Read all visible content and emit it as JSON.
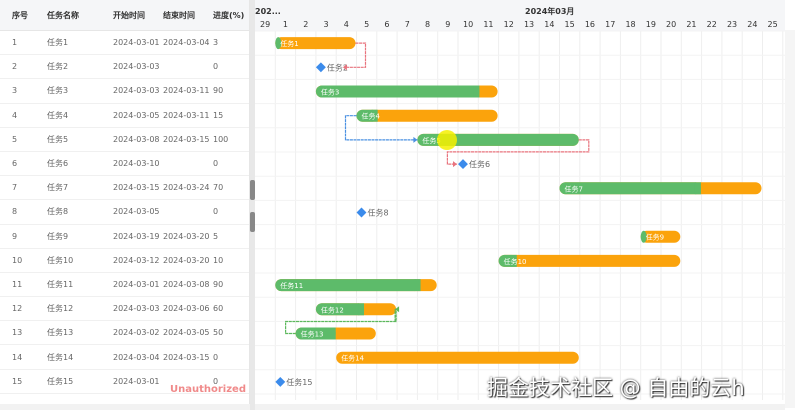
{
  "table": {
    "headers": [
      "序号",
      "任务名称",
      "开始时间",
      "结束时间",
      "进度(%)"
    ],
    "rows": [
      [
        "1",
        "任务1",
        "2024-03-01",
        "2024-03-04",
        "3"
      ],
      [
        "2",
        "任务2",
        "2024-03-03",
        "",
        "0"
      ],
      [
        "3",
        "任务3",
        "2024-03-03",
        "2024-03-11",
        "90"
      ],
      [
        "4",
        "任务4",
        "2024-03-05",
        "2024-03-11",
        "15"
      ],
      [
        "5",
        "任务5",
        "2024-03-08",
        "2024-03-15",
        "100"
      ],
      [
        "6",
        "任务6",
        "2024-03-10",
        "",
        "0"
      ],
      [
        "7",
        "任务7",
        "2024-03-15",
        "2024-03-24",
        "70"
      ],
      [
        "8",
        "任务8",
        "2024-03-05",
        "",
        "0"
      ],
      [
        "9",
        "任务9",
        "2024-03-19",
        "2024-03-20",
        "5"
      ],
      [
        "10",
        "任务10",
        "2024-03-12",
        "2024-03-20",
        "10"
      ],
      [
        "11",
        "任务11",
        "2024-03-01",
        "2024-03-08",
        "90"
      ],
      [
        "12",
        "任务12",
        "2024-03-03",
        "2024-03-06",
        "60"
      ],
      [
        "13",
        "任务13",
        "2024-03-02",
        "2024-03-05",
        "50"
      ],
      [
        "14",
        "任务14",
        "2024-03-04",
        "2024-03-15",
        "0"
      ],
      [
        "15",
        "任务15",
        "2024-03-01",
        "",
        "0"
      ]
    ]
  },
  "gantt": {
    "prev_month_label": "202...",
    "month_label": "2024年03月",
    "days": [
      "29",
      "1",
      "2",
      "3",
      "4",
      "5",
      "6",
      "7",
      "8",
      "9",
      "10",
      "11",
      "12",
      "13",
      "14",
      "15",
      "16",
      "17",
      "18",
      "19",
      "20",
      "21",
      "22",
      "23",
      "24",
      "25"
    ],
    "tasks": [
      {
        "name": "任务1",
        "start": 1,
        "end": 4,
        "progress": 3,
        "type": "bar"
      },
      {
        "name": "任务2",
        "start": 3,
        "type": "milestone"
      },
      {
        "name": "任务3",
        "start": 3,
        "end": 11,
        "progress": 90,
        "type": "bar"
      },
      {
        "name": "任务4",
        "start": 5,
        "end": 11,
        "progress": 15,
        "type": "bar"
      },
      {
        "name": "任务5",
        "start": 8,
        "end": 15,
        "progress": 100,
        "type": "bar"
      },
      {
        "name": "任务6",
        "start": 10,
        "type": "milestone"
      },
      {
        "name": "任务7",
        "start": 15,
        "end": 24,
        "progress": 70,
        "type": "bar"
      },
      {
        "name": "任务8",
        "start": 5,
        "type": "milestone"
      },
      {
        "name": "任务9",
        "start": 19,
        "end": 20,
        "progress": 5,
        "type": "bar"
      },
      {
        "name": "任务10",
        "start": 12,
        "end": 20,
        "progress": 10,
        "type": "bar"
      },
      {
        "name": "任务11",
        "start": 1,
        "end": 8,
        "progress": 90,
        "type": "bar"
      },
      {
        "name": "任务12",
        "start": 3,
        "end": 6,
        "progress": 60,
        "type": "bar"
      },
      {
        "name": "任务13",
        "start": 2,
        "end": 5,
        "progress": 50,
        "type": "bar"
      },
      {
        "name": "任务14",
        "start": 4,
        "end": 15,
        "progress": 0,
        "type": "bar"
      },
      {
        "name": "任务15",
        "start": 1,
        "type": "milestone"
      }
    ],
    "links": [
      {
        "from": 1,
        "to": 2,
        "color": "#e8737d"
      },
      {
        "from": 4,
        "to": 5,
        "color": "#4a90e2"
      },
      {
        "from": 5,
        "to": 6,
        "color": "#e8737d"
      },
      {
        "from": 13,
        "to": 12,
        "color": "#5cb85c"
      }
    ],
    "colors": {
      "progress": "#5dbb6a",
      "remaining": "#fba30c",
      "milestone": "#3b8beb",
      "grid": "#eeeeee",
      "header_bg": "#f5f6f8"
    }
  },
  "status_text": "Unauthorized",
  "watermark": "掘金技术社区 @ 自由的云h"
}
